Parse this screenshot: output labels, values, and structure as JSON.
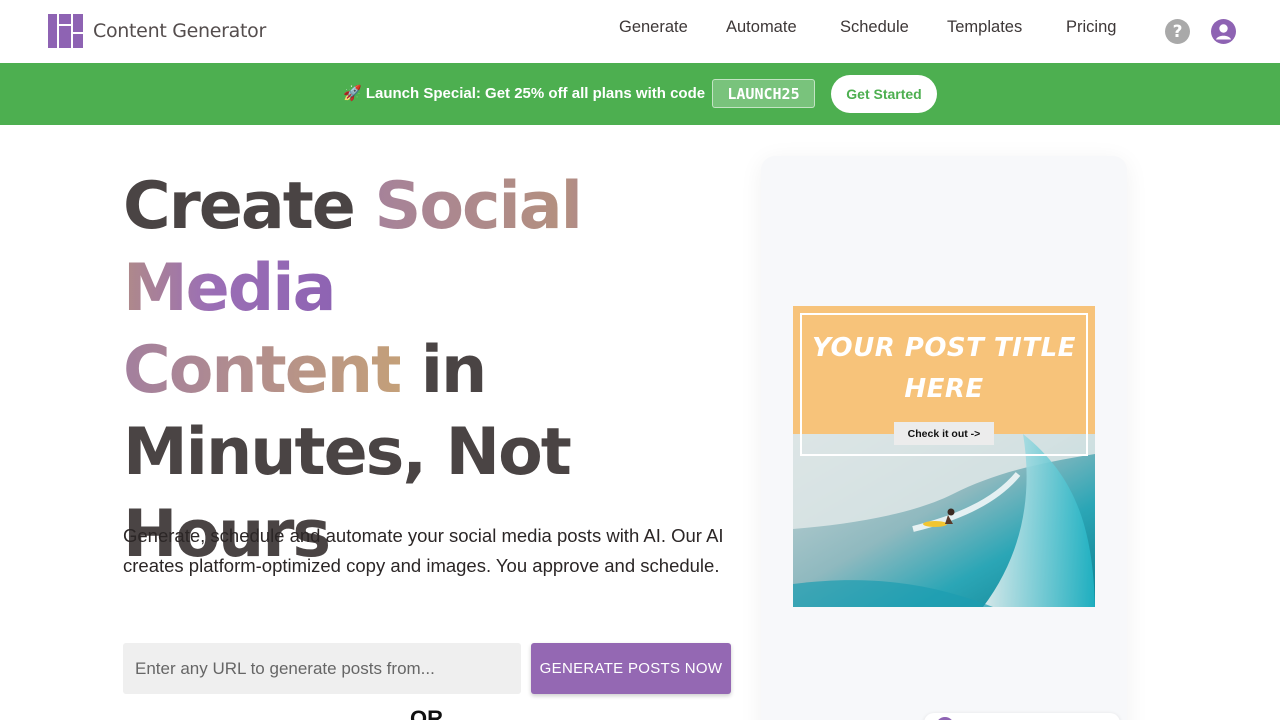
{
  "header": {
    "brand": "Content Generator",
    "nav": [
      {
        "label": "Generate"
      },
      {
        "label": "Automate"
      },
      {
        "label": "Schedule"
      },
      {
        "label": "Templates"
      },
      {
        "label": "Pricing"
      }
    ],
    "help_icon": "question-circle-icon",
    "user_icon": "user-circle-icon",
    "help_glyph": "?"
  },
  "banner": {
    "text": "🚀 Launch Special: Get 25% off all plans with code",
    "code": "LAUNCH25",
    "cta": "Get Started",
    "color": "#4daf50"
  },
  "hero": {
    "title_part1": "Create ",
    "title_highlight1": "Social Media",
    "title_highlight2": "Content",
    "title_part2": " in",
    "title_part3": "Minutes, Not",
    "title_part4": "Hours",
    "subtitle": "Generate, schedule and automate your social media posts with AI. Our AI creates platform-optimized copy and images. You approve and schedule.",
    "url_placeholder": "Enter any URL to generate posts from...",
    "generate_button": "GENERATE POSTS NOW",
    "or_text": "OR",
    "accent": "#9468b3"
  },
  "preview": {
    "post_title_line1": "YOUR POST TITLE",
    "post_title_line2": "HERE",
    "post_cta": "Check it out ->"
  }
}
